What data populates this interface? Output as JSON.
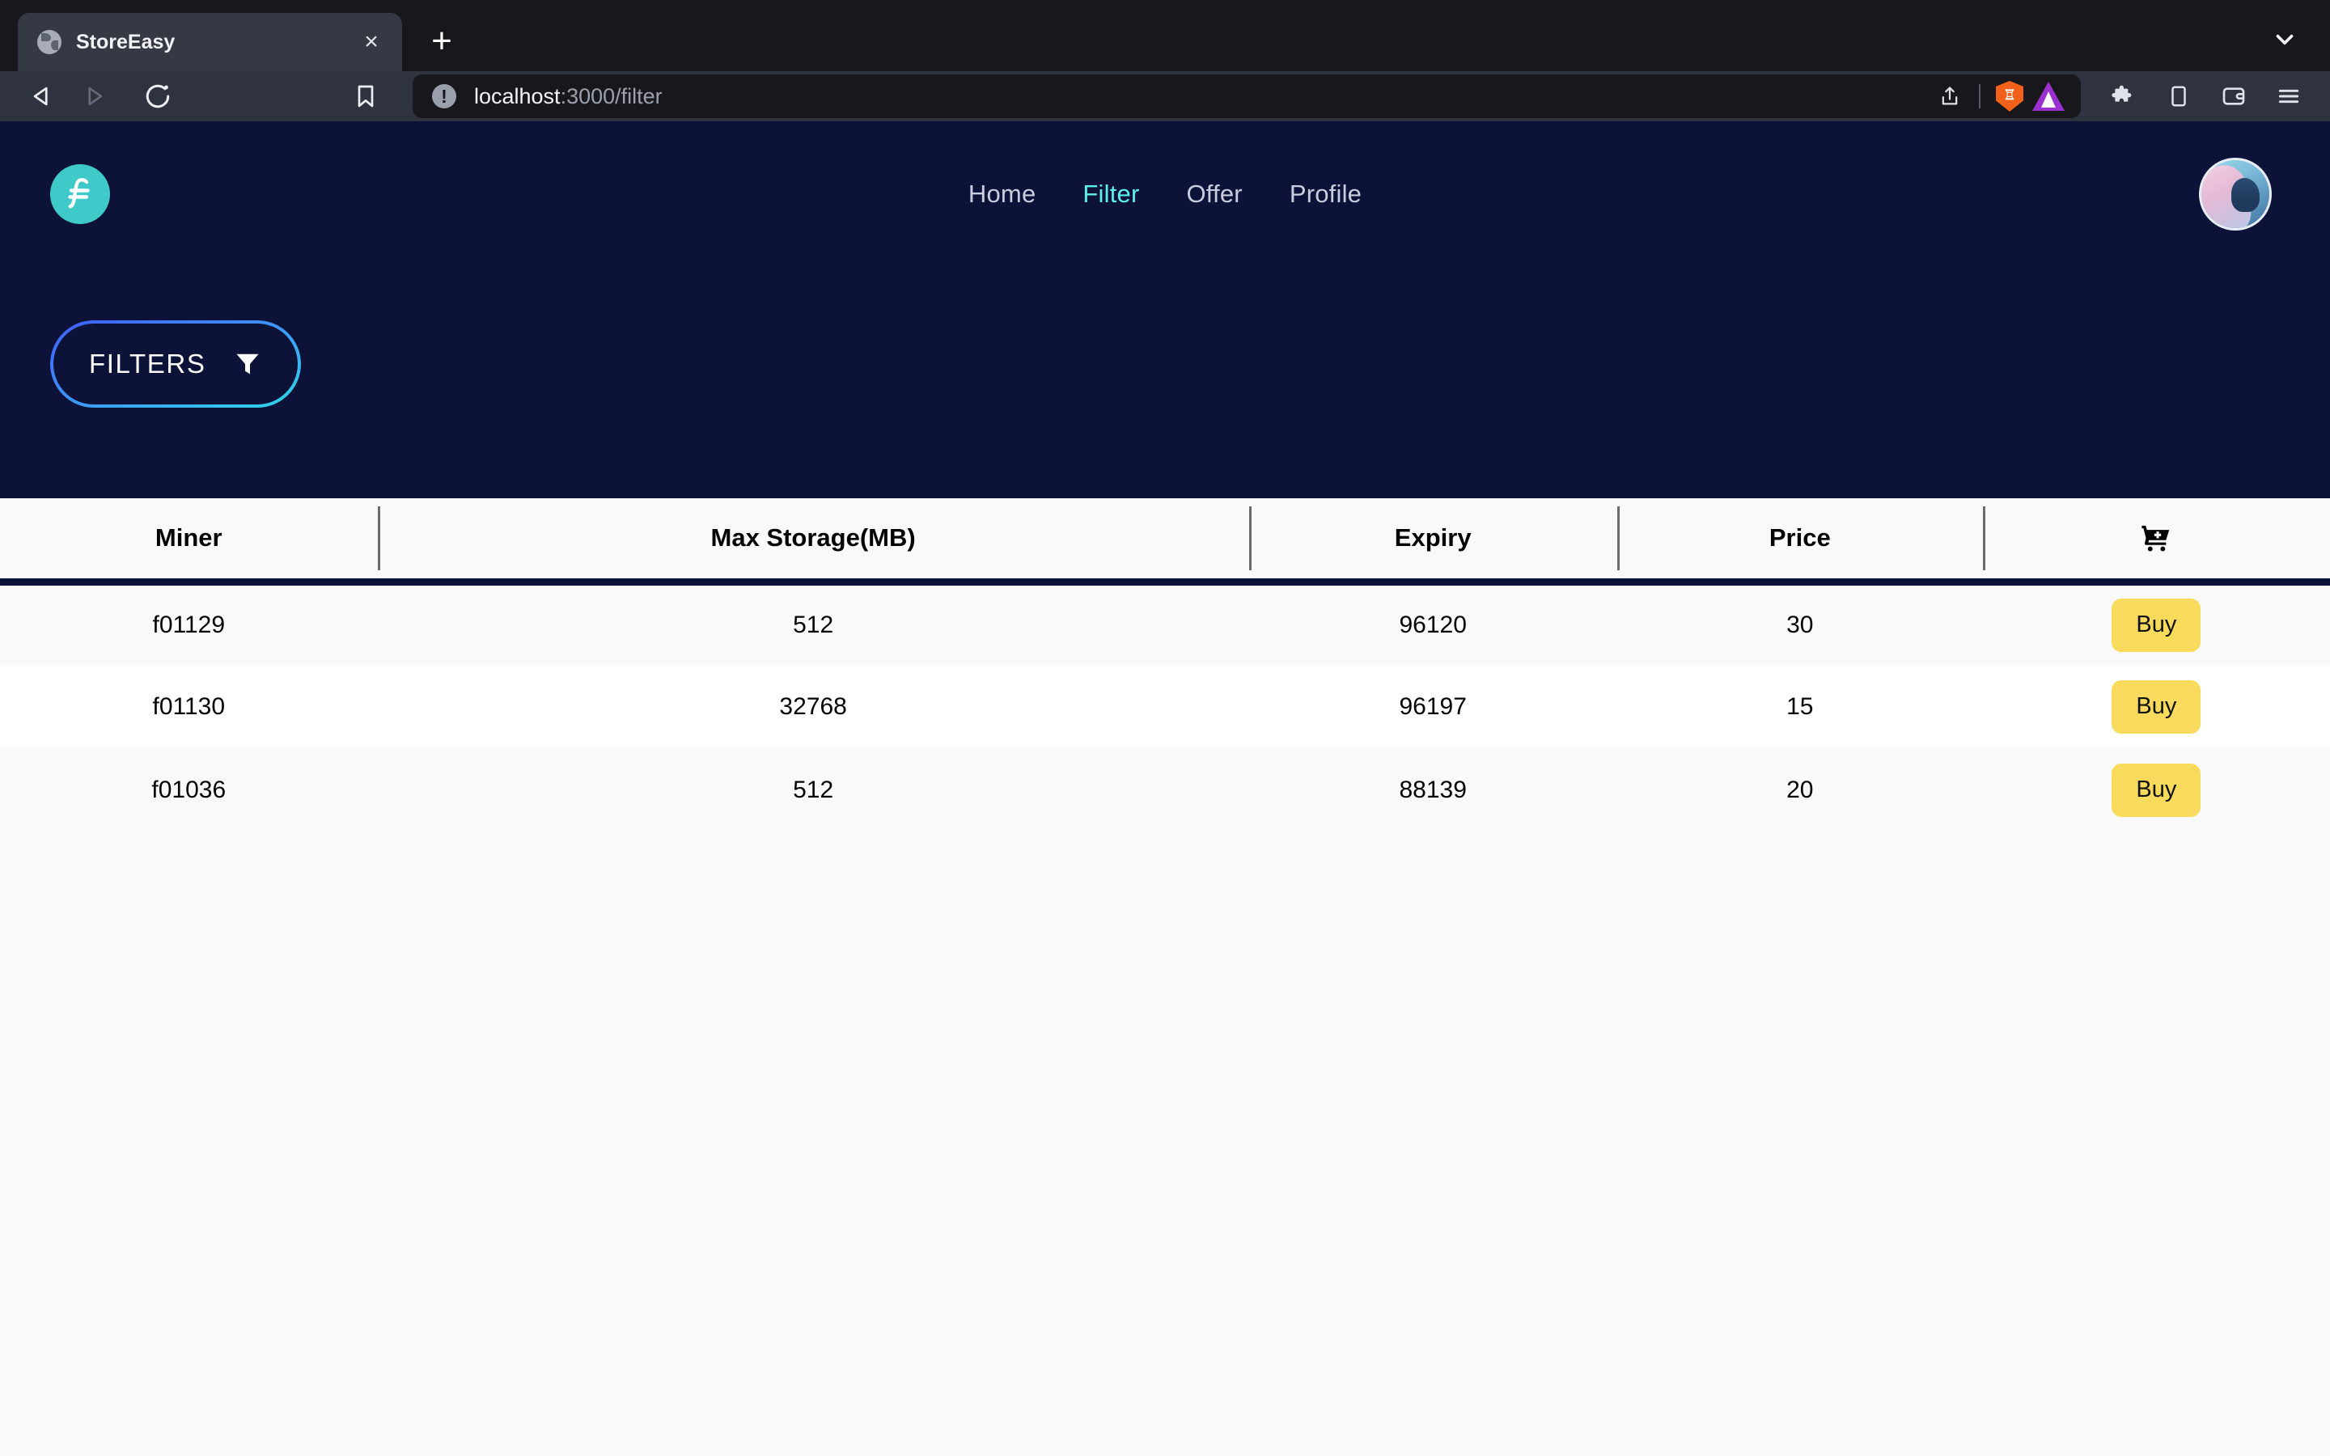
{
  "browser": {
    "tab": {
      "title": "StoreEasy",
      "favicon": "globe-icon",
      "close": "×"
    },
    "new_tab": "+",
    "tab_search": "chevron-down-icon",
    "nav": {
      "back": "◁",
      "forward": "▷",
      "reload": "↻"
    },
    "bookmark": "bookmark-icon",
    "url": {
      "scheme_host": "localhost",
      "rest": ":3000/filter",
      "info_badge": "!"
    },
    "url_actions": [
      "share-icon",
      "brave-shields-icon",
      "brave-rewards-icon"
    ],
    "toolbar_actions": [
      "extensions-icon",
      "sidebar-icon",
      "wallet-icon",
      "menu-icon"
    ]
  },
  "app": {
    "logo": "filecoin-logo",
    "nav": [
      {
        "label": "Home",
        "active": false
      },
      {
        "label": "Filter",
        "active": true
      },
      {
        "label": "Offer",
        "active": false
      },
      {
        "label": "Profile",
        "active": false
      }
    ],
    "avatar": "user-avatar",
    "filters_button": {
      "label": "FILTERS",
      "icon": "funnel-icon"
    },
    "table": {
      "columns": [
        "Miner",
        "Max Storage(MB)",
        "Expiry",
        "Price",
        "cart-plus-icon"
      ],
      "rows": [
        {
          "miner": "f01129",
          "storage": "512",
          "expiry": "96120",
          "price": "30",
          "action": "Buy"
        },
        {
          "miner": "f01130",
          "storage": "32768",
          "expiry": "96197",
          "price": "15",
          "action": "Buy"
        },
        {
          "miner": "f01036",
          "storage": "512",
          "expiry": "88139",
          "price": "20",
          "action": "Buy"
        }
      ]
    }
  },
  "colors": {
    "hero_navy": "#0c1238",
    "accent_cyan": "#5ef0ec",
    "buy_yellow": "#f8db5d",
    "logo_teal": "#3fc9c9",
    "gradient_start": "#3f5ef7",
    "gradient_end": "#2fd7e8"
  }
}
